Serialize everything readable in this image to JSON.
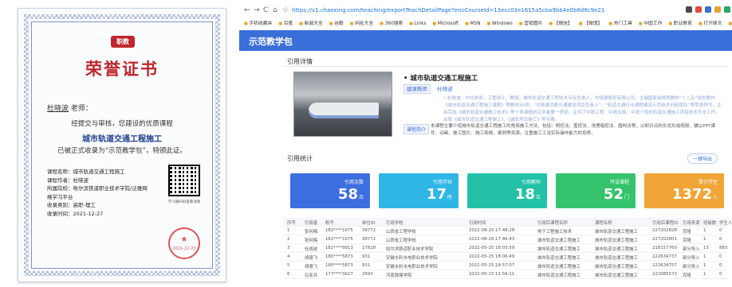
{
  "certificate": {
    "logo_text": "职教",
    "title": "荣誉证书",
    "recipient_name": "杜晓波",
    "recipient_suffix": "老师：",
    "line1": "经提交与审核，您建设的优质课程",
    "course": "城市轨道交通工程施工",
    "line2": "已被正式收录为“示范教学包”，特颁此证。",
    "info": [
      "课程名称：城市轨道交通工程施工",
      "课程作者：杜晓波",
      "所属院校：哈尔滨铁道职业技术学院/泛雅网",
      "络学习平台",
      "收录类别：高职-理工",
      "收录时间：2021-12-27"
    ],
    "qr_caption": "学习通扫码查看详情",
    "seal_text": "2021-12-20"
  },
  "browser": {
    "url": "https://v1.chaoxing.com/teaching/exportTeachDetailPage?encCourseId=13ecc03e1615a5cba9bb4e0b6d8c9e21",
    "nav": [
      "←",
      "→",
      "C",
      "⌂",
      "☆"
    ],
    "ext_colors": [
      "#4a4a4a",
      "#e14b3b",
      "#3a6fd9",
      "#e6a42b",
      "#2aa56b"
    ],
    "bookmarks": [
      "手机收藏夹",
      "百度",
      "新闻大全",
      "谷歌",
      "网址大全",
      "360搜索",
      "Links",
      "Microsoft",
      "MSN",
      "Windows",
      "营销图片",
      "【微信】",
      "【微博】",
      "热门工具",
      "中国工作",
      "职业教育",
      "打开原文",
      "智慧职教",
      "素材资源",
      "科研"
    ]
  },
  "app": {
    "title": "示范教学包",
    "citation_detail_heading": "引用详情",
    "course_title": "• 城市轨道交通工程施工",
    "creator_label": "建课教师",
    "creator_name": "杜晓波",
    "description": "• 杜晓波，中共党员，工程硕士，教授，城市轨道交通工程技术专业负责人，中铁建股份有限公司，主编国家级规划教材“十二五”规划教材《城市轨道交通工程施工课程》等教材30项，“中铁建优质交通建设项目负责人”，“轨道交通行业课程建设示范技术创新团队”等荣誉称号，主持完成《城市轨道交通施工技术》等十项课题研究学者第一获奖。主持了中铁工程、中铁五局、中铁十局的轨道交通施工项目技术开发工作，出版《城市轨道交通工程施工》、《城轨项目施工》等专著。",
    "intro_label": "课程简介",
    "intro": "本课程主要介绍城市轨道交通工程施工的常用施工方法，包括：明挖法、盖挖法、浅埋暗挖法、盾构法等，以知识点的形式形成视频、辅以PPT课件、动画、施工图片、施工视频、案例等资源，注重施工工法实际操作能力的培养。",
    "stats_heading": "引用统计",
    "refresh_label": "一键导出",
    "cards": [
      {
        "label": "引用次数",
        "value": "58",
        "unit": "次",
        "color": "#3d6fe0"
      },
      {
        "label": "引用学校",
        "value": "17",
        "unit": "所",
        "color": "#2fb6e6"
      },
      {
        "label": "引用教师",
        "value": "18",
        "unit": "位",
        "color": "#23c2a8"
      },
      {
        "label": "开设课程",
        "value": "52",
        "unit": "门",
        "color": "#35c46d"
      },
      {
        "label": "累计学生",
        "value": "1372",
        "unit": "人",
        "color": "#f0a536"
      }
    ],
    "table": {
      "headers": [
        "序号",
        "引用者",
        "账号",
        "单位ID",
        "引用学校",
        "引用时间",
        "引用后课程名称",
        "课程名称",
        "引用后课程ID",
        "引用来源",
        "班级数",
        "学生人数"
      ],
      "rows": [
        [
          "1",
          "张何梅",
          "182****1675",
          "39772",
          "山西省工程学校",
          "2022-08-20 17:48:28",
          "地下工程施工技术",
          "城市轨道交通工程施工",
          "227202828",
          "克隆",
          "1",
          "0"
        ],
        [
          "2",
          "张何梅",
          "182****1675",
          "39772",
          "山西省工程学校",
          "2022-08-20 17:46:43",
          "城市轨道交通工程施工",
          "城市轨道交通工程施工",
          "227202801",
          "克隆",
          "1",
          "0"
        ],
        [
          "3",
          "杜晓波",
          "182****9913",
          "27828",
          "哈尔滨铁道职业技术学院",
          "2022-05-25 18:03:59",
          "城市轨道交通工程施工",
          "城市轨道交通工程施工",
          "218157760",
          "部分导入",
          "13",
          "883"
        ],
        [
          "4",
          "胡德飞",
          "180****5873",
          "931",
          "安徽水利水电职业技术学院",
          "2022-05-25 18:06:49",
          "城市轨道交通工程施工",
          "城市轨道交通工程施工",
          "222634737",
          "部分导入",
          "1",
          "0"
        ],
        [
          "5",
          "胡德飞",
          "180****5873",
          "931",
          "安徽水利水电职业技术学院",
          "2022-05-25 18:57:07",
          "城市轨道交通工程施工",
          "城市轨道交通工程施工",
          "222634757",
          "部分导入",
          "1",
          "0"
        ],
        [
          "6",
          "吕亚兵",
          "177****3627",
          "2693",
          "河南铁建学院",
          "2022-05-23 11:56:11",
          "城市轨道交通工程施工",
          "城市轨道交通工程施工",
          "222085573",
          "克隆",
          "1",
          "0"
        ]
      ]
    }
  }
}
